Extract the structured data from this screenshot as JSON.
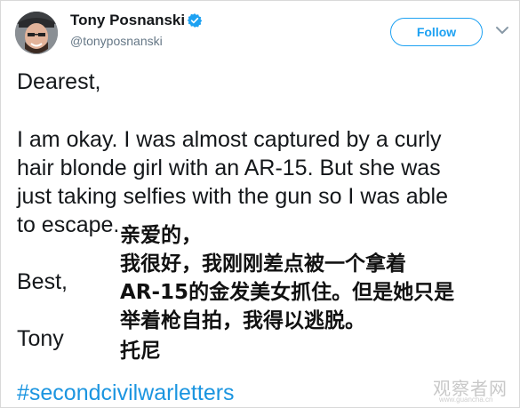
{
  "author": {
    "name": "Tony Posnanski",
    "handle": "@tonyposnanski",
    "verified": true,
    "avatar_icon": "avatar-photo"
  },
  "header": {
    "follow_label": "Follow",
    "menu_icon": "chevron-down-icon"
  },
  "tweet": {
    "lines": [
      "Dearest,",
      "I am okay. I was almost captured by a curly",
      "hair blonde girl with an AR-15. But she was",
      "just taking selfies with the gun so I was able",
      "to escape.",
      "Best,",
      "Tony"
    ],
    "hashtag": "#secondcivilwarletters"
  },
  "overlay_translation": [
    "亲爱的，",
    "我很好，我刚刚差点被一个拿着",
    "AR-15的金发美女抓住。但是她只是",
    "举着枪自拍，我得以逃脱。",
    "托尼"
  ],
  "watermark": {
    "text": "观察者网",
    "subtext": "www.guancha.cn"
  },
  "colors": {
    "accent": "#1da1f2",
    "hashtag": "#1b95e0",
    "handle": "#657786",
    "text": "#14171a"
  }
}
